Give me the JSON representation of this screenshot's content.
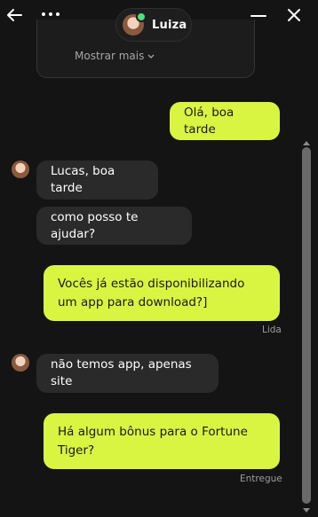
{
  "header": {
    "back_icon": "arrow-left-icon",
    "more_icon": "more-dots-icon",
    "minimize_icon": "minimize-icon",
    "close_icon": "close-icon",
    "contact_name": "Luiza",
    "online_color": "#4fe07a"
  },
  "history": {
    "show_more_label": "Mostrar mais"
  },
  "messages": [
    {
      "type": "sent",
      "text": "Olá, boa tarde",
      "status": ""
    },
    {
      "type": "received",
      "text": "Lucas, boa tarde"
    },
    {
      "type": "received",
      "text": "como posso te ajudar?"
    },
    {
      "type": "sent",
      "text": "Vocês já estão disponibilizando um app para download?]",
      "status": "Lida"
    },
    {
      "type": "received",
      "text": "não temos app, apenas site"
    },
    {
      "type": "sent",
      "text": "Há algum bônus para o Fortune Tiger?",
      "status": "Entregue"
    }
  ],
  "colors": {
    "background": "#141414",
    "sent_bubble": "#d9f542",
    "received_bubble": "#2a2a2a",
    "status_text": "#9d9d9d"
  }
}
